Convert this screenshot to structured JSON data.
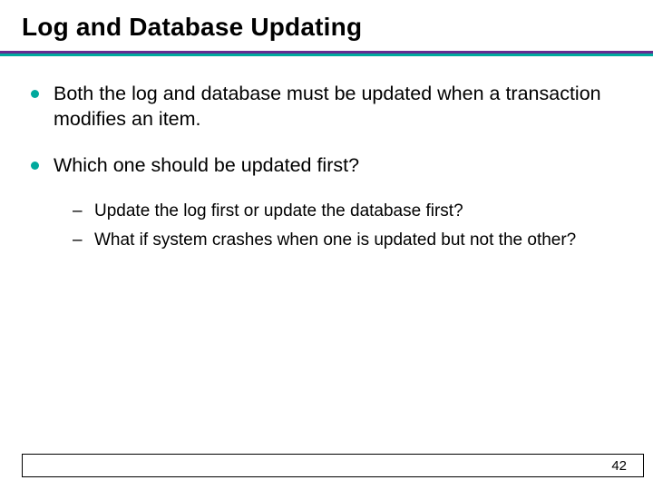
{
  "title": "Log and Database Updating",
  "bullets": [
    {
      "text": "Both the log and database must be updated when a transaction modifies an item.",
      "sub": []
    },
    {
      "text": "Which one should be updated first?",
      "sub": [
        "Update the log first or update the database first?",
        "What if system crashes when one is updated but not the other?"
      ]
    }
  ],
  "page_number": "42",
  "colors": {
    "accent_top": "#652C90",
    "accent_bottom": "#00A99D",
    "bullet_dot": "#00A99D"
  }
}
